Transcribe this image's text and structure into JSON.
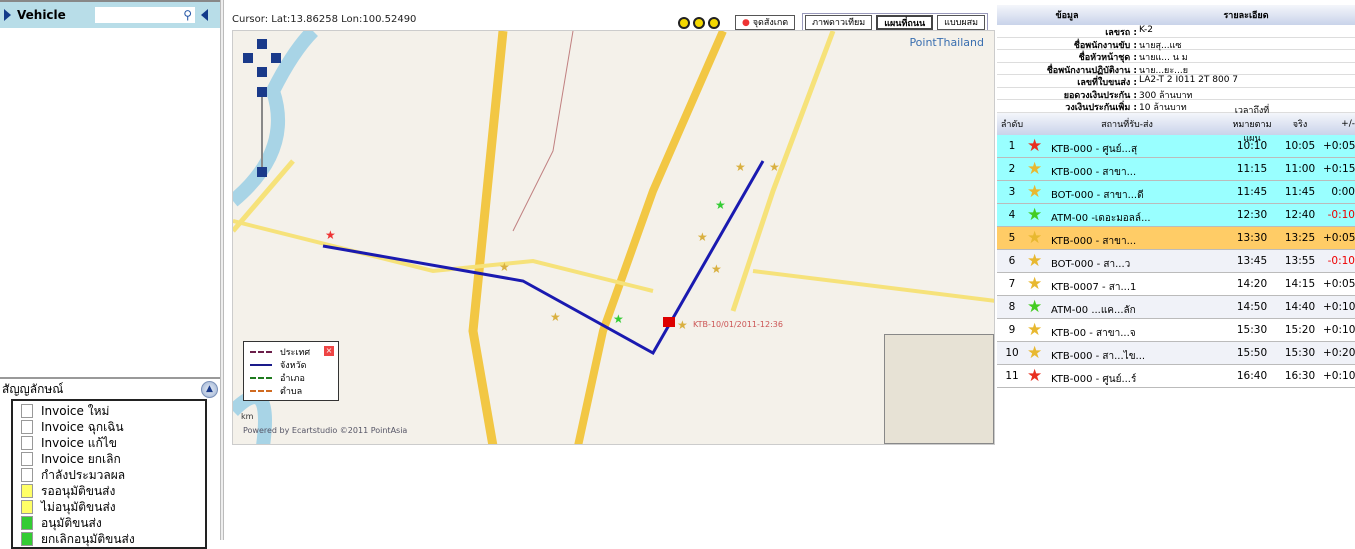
{
  "left": {
    "title": "Vehicle",
    "search_placeholder": "",
    "legend_title": "สัญญลักษณ์",
    "legend_items": [
      "Invoice ใหม่",
      "Invoice ฉุกเฉิน",
      "Invoice แก้ไข",
      "Invoice ยกเลิก",
      "กำลังประมวลผล",
      "รออนุมัติขนส่ง",
      "ไม่อนุมัติขนส่ง",
      "อนุมัติขนส่ง",
      "ยกเลิกอนุมัติขนส่ง"
    ]
  },
  "map": {
    "cursor": "Cursor: Lat:13.86258  Lon:100.52490",
    "landmark": "จุดสังเกต",
    "types": [
      "ภาพดาวเทียม",
      "แผนที่ถนน",
      "แบบผสม"
    ],
    "selected_type": "แผนที่ถนน",
    "brand": "PointThailand",
    "legend": [
      "ประเทศ",
      "จังหวัด",
      "อำเภอ",
      "ตำบล"
    ],
    "legend_colors": [
      "#6b1e4a",
      "#1a1a8a",
      "#1e7a1e",
      "#d06a20"
    ],
    "scale": "km",
    "powered": "Powered by Ecartstudio ©2011 PointAsia",
    "vehicle_label": "KTB-10/01/2011-12:36"
  },
  "details": {
    "header": [
      "ข้อมูล",
      "รายละเอียด"
    ],
    "info": [
      {
        "k": "เลขรถ :",
        "v": "K-2"
      },
      {
        "k": "ชื่อพนักงานขับ :",
        "v": "นายสุ...แซ"
      },
      {
        "k": "ชื่อหัวหน้าชุด :",
        "v": "นายแ... น ม"
      },
      {
        "k": "ชื่อพนักงานปฏิบัติงาน :",
        "v": "นาย...ยะ...ย"
      },
      {
        "k": "เลขที่ใบขนส่ง :",
        "v": "LA2-T 2 I011 2T 800 7"
      },
      {
        "k": "ยอดวงเงินประกัน :",
        "v": "300 ล้านบาท"
      },
      {
        "k": "วงเงินประกันเพิ่ม :",
        "v": "10 ล้านบาท"
      }
    ],
    "columns": [
      "ลำดับ",
      "สถานที่รับ-ส่ง",
      "เวลาถึงที่หมายตามแผน",
      "จริง",
      "+/-"
    ],
    "rows": [
      {
        "n": "1",
        "star": "red",
        "place": "KTB-000 - ศูนย์...สุ",
        "plan": "10:10",
        "actual": "10:05",
        "diff": "+0:05",
        "bg": "#99ffff"
      },
      {
        "n": "2",
        "star": "gold",
        "place": "KTB-000 - สาขา...",
        "plan": "11:15",
        "actual": "11:00",
        "diff": "+0:15",
        "bg": "#99ffff"
      },
      {
        "n": "3",
        "star": "gold",
        "place": "BOT-000 - สาขา...ดี",
        "plan": "11:45",
        "actual": "11:45",
        "diff": "0:00",
        "bg": "#99ffff"
      },
      {
        "n": "4",
        "star": "green",
        "place": "ATM-00 -เดอะมอลล์...",
        "plan": "12:30",
        "actual": "12:40",
        "diff": "-0:10",
        "bg": "#99ffff"
      },
      {
        "n": "5",
        "star": "gold",
        "place": "KTB-000 - สาขา...",
        "plan": "13:30",
        "actual": "13:25",
        "diff": "+0:05",
        "bg": "#ffcc66"
      },
      {
        "n": "6",
        "star": "gold",
        "place": "BOT-000 - สา...ว",
        "plan": "13:45",
        "actual": "13:55",
        "diff": "-0:10",
        "bg": "#f0f2f8"
      },
      {
        "n": "7",
        "star": "gold",
        "place": "KTB-0007 - สา...1",
        "plan": "14:20",
        "actual": "14:15",
        "diff": "+0:05",
        "bg": "#ffffff"
      },
      {
        "n": "8",
        "star": "green",
        "place": "ATM-00 ...แค...ลัก",
        "plan": "14:50",
        "actual": "14:40",
        "diff": "+0:10",
        "bg": "#f0f2f8"
      },
      {
        "n": "9",
        "star": "gold",
        "place": "KTB-00 - สาขา...จ",
        "plan": "15:30",
        "actual": "15:20",
        "diff": "+0:10",
        "bg": "#ffffff"
      },
      {
        "n": "10",
        "star": "gold",
        "place": "KTB-000 - สา...ไข...",
        "plan": "15:50",
        "actual": "15:30",
        "diff": "+0:20",
        "bg": "#f0f2f8"
      },
      {
        "n": "11",
        "star": "red",
        "place": "KTB-000 - ศูนย์...ร์",
        "plan": "16:40",
        "actual": "16:30",
        "diff": "+0:10",
        "bg": "#ffffff"
      }
    ]
  }
}
